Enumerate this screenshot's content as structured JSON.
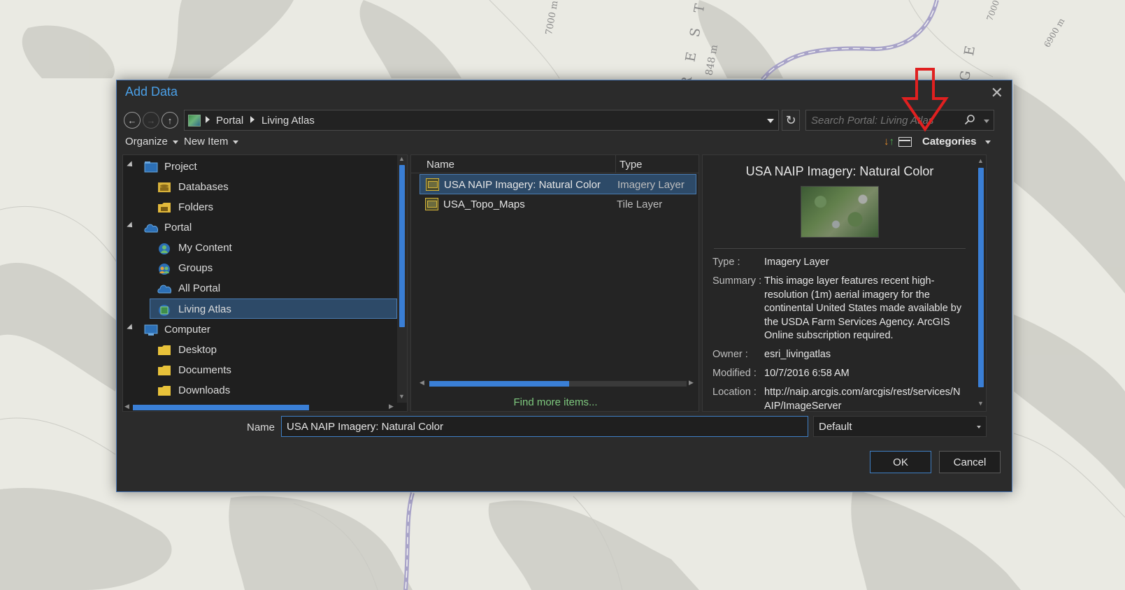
{
  "map": {
    "labels": [
      "7000 m",
      "848 m",
      "6900 m",
      "7000",
      "R E S T",
      "G E"
    ]
  },
  "dialog": {
    "title": "Add Data",
    "close_label": "✕"
  },
  "nav": {
    "back_label": "←",
    "forward_label": "→",
    "up_label": "↑",
    "breadcrumb": [
      "Portal",
      "Living Atlas"
    ],
    "refresh_label": "↻",
    "search_placeholder": "Search Portal: Living Atlas"
  },
  "toolbar": {
    "organize_label": "Organize",
    "new_item_label": "New Item",
    "categories_label": "Categories",
    "sort_icon": "sort-icon"
  },
  "tree": {
    "items": [
      {
        "label": "Project",
        "icon": "project-icon",
        "expanded": true
      },
      {
        "label": "Databases",
        "icon": "database-icon"
      },
      {
        "label": "Folders",
        "icon": "folder-icon"
      },
      {
        "label": "Portal",
        "icon": "portal-icon",
        "expanded": true
      },
      {
        "label": "My Content",
        "icon": "my-content-icon"
      },
      {
        "label": "Groups",
        "icon": "groups-icon"
      },
      {
        "label": "All Portal",
        "icon": "cloud-icon"
      },
      {
        "label": "Living Atlas",
        "icon": "living-atlas-icon",
        "selected": true
      },
      {
        "label": "Computer",
        "icon": "computer-icon",
        "expanded": true
      },
      {
        "label": "Desktop",
        "icon": "folder-icon"
      },
      {
        "label": "Documents",
        "icon": "folder-icon"
      },
      {
        "label": "Downloads",
        "icon": "folder-icon"
      }
    ]
  },
  "list": {
    "columns": [
      "Name",
      "Type"
    ],
    "rows": [
      {
        "name": "USA NAIP Imagery: Natural Color",
        "type": "Imagery Layer",
        "selected": true
      },
      {
        "name": "USA_Topo_Maps",
        "type": "Tile Layer"
      }
    ],
    "find_more_label": "Find more items..."
  },
  "details": {
    "title": "USA NAIP Imagery: Natural Color",
    "type_label": "Type :",
    "type_value": "Imagery Layer",
    "summary_label": "Summary :",
    "summary_value": "This image layer features recent high-resolution (1m) aerial imagery for the continental United States made available by the USDA Farm Services Agency. ArcGIS Online subscription required.",
    "owner_label": "Owner :",
    "owner_value": "esri_livingatlas",
    "modified_label": "Modified :",
    "modified_value": "10/7/2016 6:58 AM",
    "location_label": "Location :",
    "location_value": "http://naip.arcgis.com/arcgis/rest/services/NAIP/ImageServer"
  },
  "bottom": {
    "name_label": "Name",
    "name_value": "USA NAIP Imagery: Natural Color",
    "filter_value": "Default",
    "ok_label": "OK",
    "cancel_label": "Cancel"
  },
  "colors": {
    "accent": "#4a9fe6",
    "selection": "#2d4a68",
    "scrollbar": "#3a7fd6",
    "link_green": "#7ec87e",
    "annotation_red": "#e02020"
  }
}
